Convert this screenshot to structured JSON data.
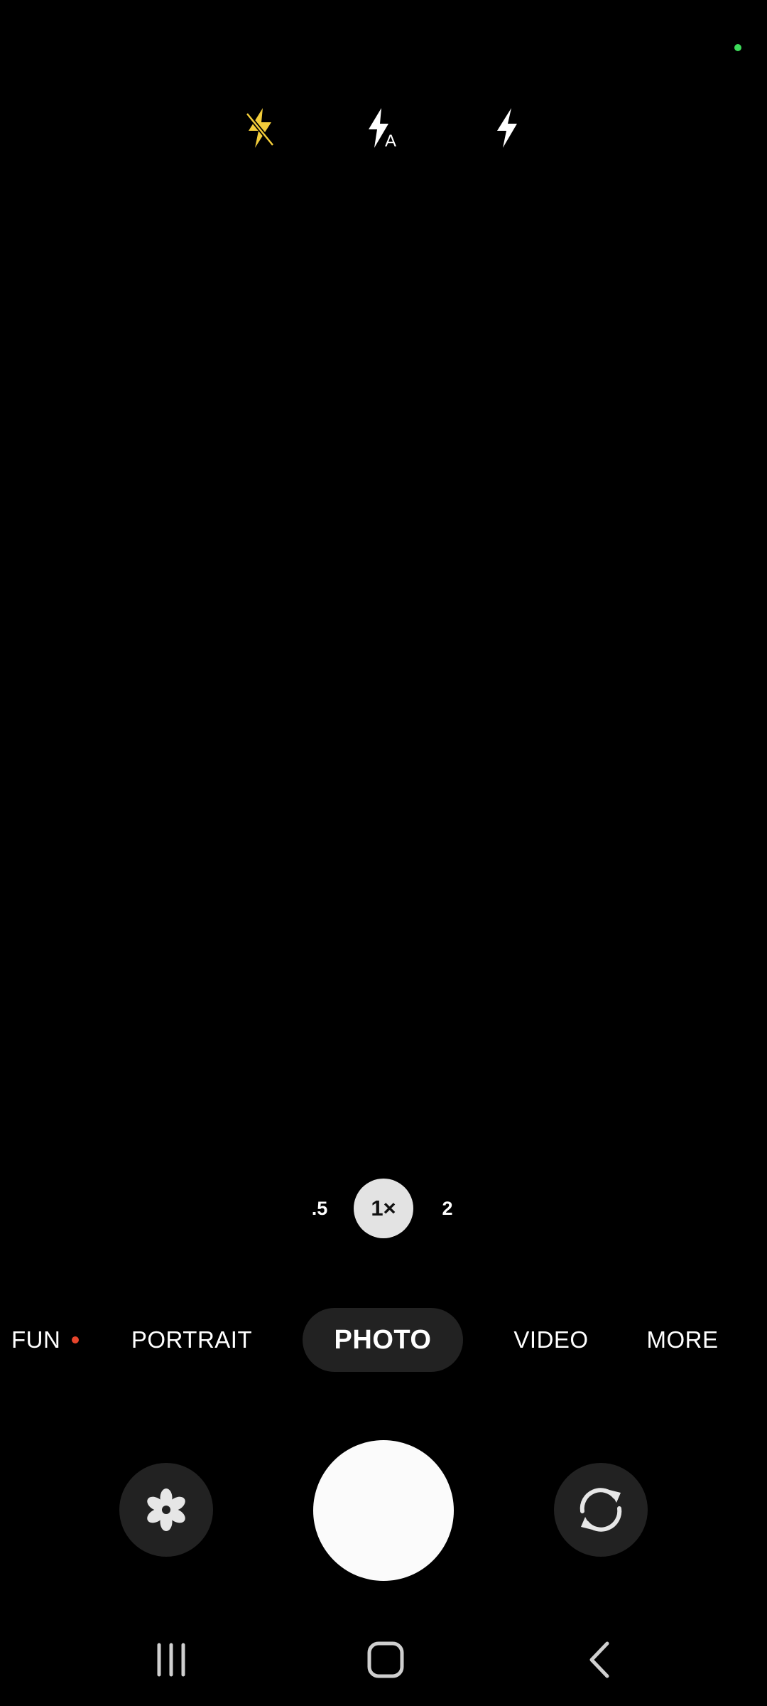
{
  "status": {
    "privacy_indicator_color": "#3ddc5a"
  },
  "flash": {
    "options": [
      {
        "name": "flash-off",
        "icon": "flash-off-icon",
        "selected": true,
        "color": "#f3cd3a"
      },
      {
        "name": "flash-auto",
        "icon": "flash-auto-icon",
        "selected": false,
        "color": "#ffffff"
      },
      {
        "name": "flash-on",
        "icon": "flash-on-icon",
        "selected": false,
        "color": "#ffffff"
      }
    ]
  },
  "zoom": {
    "options": [
      ".5",
      "1×",
      "2"
    ],
    "selected": "1×"
  },
  "modes": {
    "fun": "FUN",
    "portrait": "PORTRAIT",
    "photo": "PHOTO",
    "video": "VIDEO",
    "more": "MORE",
    "selected": "PHOTO",
    "new_badge_color": "#e8452c"
  },
  "controls": {
    "effects_icon": "flower-icon",
    "shutter_icon": "shutter-button",
    "switch_camera_icon": "switch-camera-icon"
  },
  "nav": {
    "recents_icon": "recents-icon",
    "home_icon": "home-icon",
    "back_icon": "back-icon"
  }
}
